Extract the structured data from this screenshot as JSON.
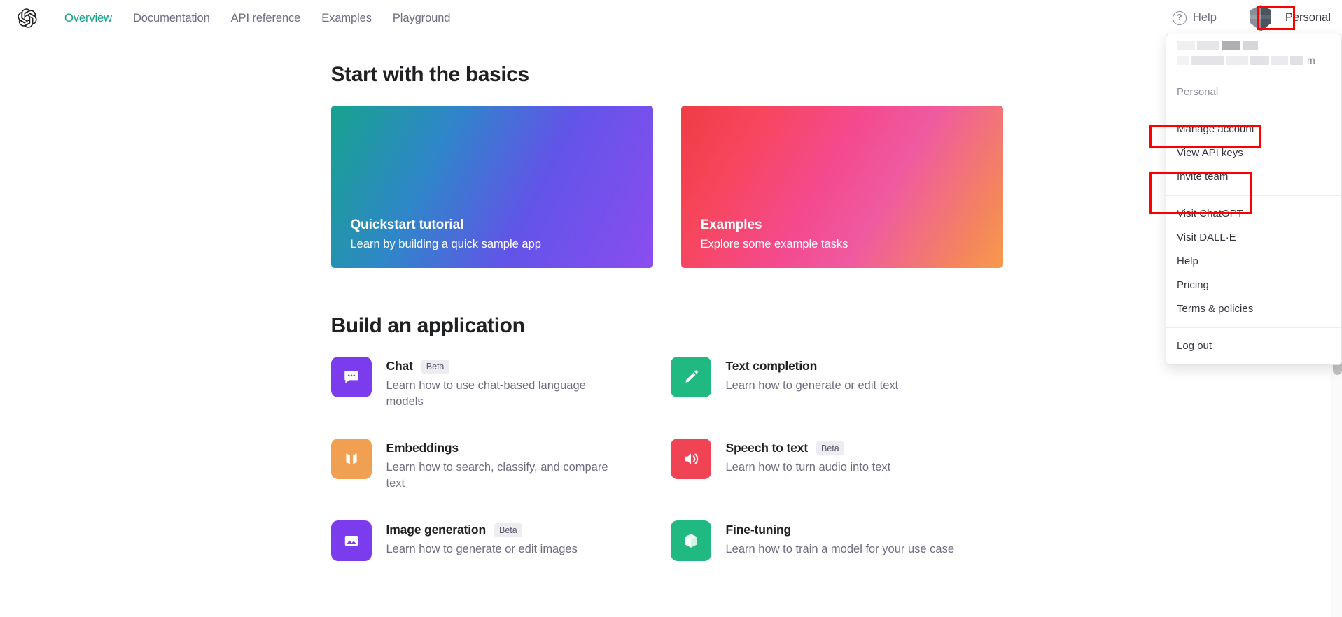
{
  "topbar": {
    "logo_icon": "openai-logo-icon",
    "nav": [
      {
        "label": "Overview",
        "active": true
      },
      {
        "label": "Documentation",
        "active": false
      },
      {
        "label": "API reference",
        "active": false
      },
      {
        "label": "Examples",
        "active": false
      },
      {
        "label": "Playground",
        "active": false
      }
    ],
    "help_label": "Help",
    "help_icon": "question-mark-circle-icon",
    "help_glyph": "?",
    "avatar_icon": "org-avatar-icon",
    "account_label": "Personal"
  },
  "dropdown": {
    "identity": {
      "name_redacted": true,
      "email_redacted": true,
      "email_visible_tail": "m"
    },
    "workspace_label": "Personal",
    "group_account": [
      "Manage account",
      "View API keys",
      "Invite team"
    ],
    "group_links": [
      "Visit ChatGPT",
      "Visit DALL·E",
      "Help",
      "Pricing",
      "Terms & policies"
    ],
    "group_session": [
      "Log out"
    ]
  },
  "annotations": {
    "color": "#ff0000",
    "boxes": [
      {
        "target": "Personal"
      },
      {
        "target": "View API keys"
      },
      {
        "target": "Visit ChatGPT / Visit DALL·E"
      }
    ]
  },
  "main": {
    "basics": {
      "title": "Start with the basics",
      "cards": [
        {
          "title": "Quickstart tutorial",
          "subtitle": "Learn by building a quick sample app",
          "gradient_from": "#17a28e",
          "gradient_to": "#8b4df0"
        },
        {
          "title": "Examples",
          "subtitle": "Explore some example tasks",
          "gradient_from": "#f03c44",
          "gradient_to": "#f79a4c"
        }
      ]
    },
    "build": {
      "title": "Build an application",
      "cards": [
        {
          "title": "Chat",
          "badge": "Beta",
          "desc": "Learn how to use chat-based language models",
          "icon": "chat-bubble-icon",
          "color": "#7a3ced"
        },
        {
          "title": "Text completion",
          "badge": "",
          "desc": "Learn how to generate or edit text",
          "icon": "pencil-icon",
          "color": "#1fb981"
        },
        {
          "title": "Embeddings",
          "badge": "",
          "desc": "Learn how to search, classify, and compare text",
          "icon": "embeddings-bars-icon",
          "color": "#f5a councils"
        },
        {
          "title": "Speech to text",
          "badge": "Beta",
          "desc": "Learn how to turn audio into text",
          "icon": "speaker-icon",
          "color": "#f04455"
        },
        {
          "title": "Image generation",
          "badge": "Beta",
          "desc": "Learn how to generate or edit images",
          "icon": "image-icon",
          "color": "#7a3ced"
        },
        {
          "title": "Fine-tuning",
          "badge": "",
          "desc": "Learn how to train a model for your use case",
          "icon": "cube-icon",
          "color": "#1fb981"
        }
      ]
    }
  }
}
